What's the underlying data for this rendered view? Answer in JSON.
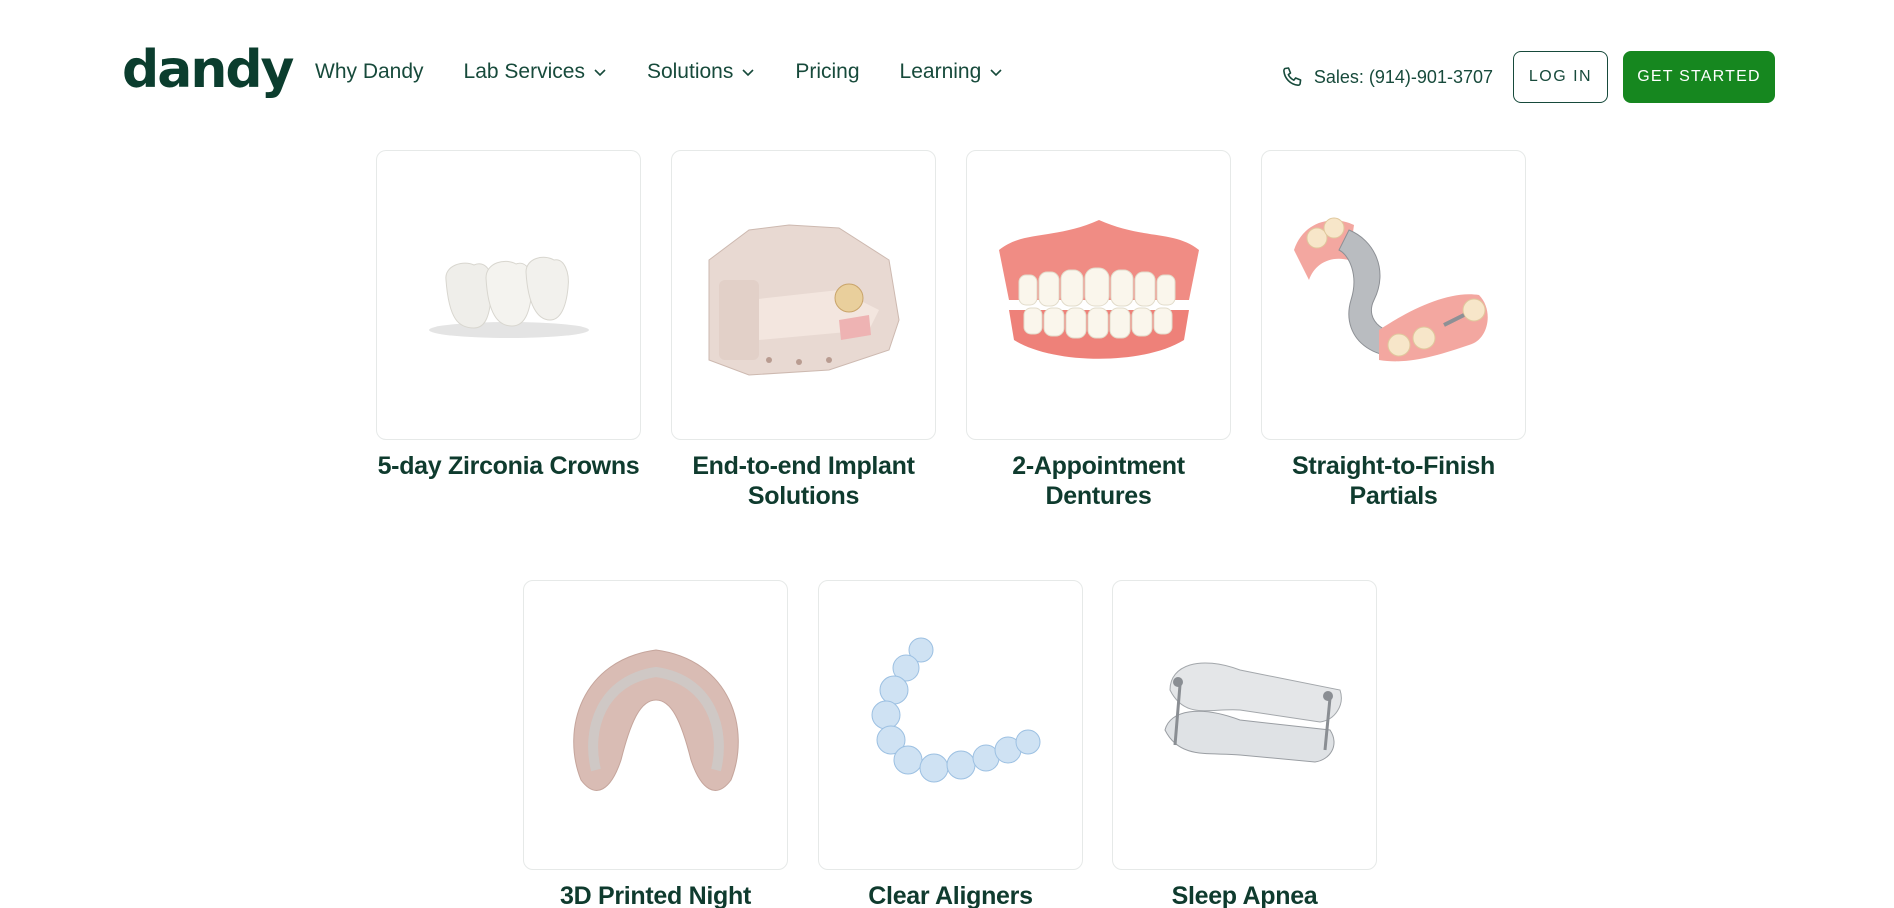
{
  "header": {
    "logo": "dandy",
    "nav": [
      {
        "label": "Why Dandy",
        "dropdown": false
      },
      {
        "label": "Lab Services",
        "dropdown": true
      },
      {
        "label": "Solutions",
        "dropdown": true
      },
      {
        "label": "Pricing",
        "dropdown": false
      },
      {
        "label": "Learning",
        "dropdown": true
      }
    ],
    "phone": "Sales: (914)-901-3707",
    "login": "LOG IN",
    "get_started": "GET STARTED"
  },
  "products": [
    {
      "label": "5-day Zirconia Crowns",
      "icon": "zirconia-crowns-image"
    },
    {
      "label": "End-to-end Implant Solutions",
      "icon": "implant-model-image"
    },
    {
      "label": "2-Appointment Dentures",
      "icon": "dentures-image"
    },
    {
      "label": "Straight-to-Finish Partials",
      "icon": "partial-denture-image"
    },
    {
      "label": "3D Printed Night",
      "icon": "night-guard-image"
    },
    {
      "label": "Clear Aligners",
      "icon": "clear-aligner-image"
    },
    {
      "label": "Sleep Apnea",
      "icon": "sleep-apnea-appliance-image"
    }
  ],
  "colors": {
    "brand_dark": "#0b3d2e",
    "accent_green": "#16871f"
  }
}
